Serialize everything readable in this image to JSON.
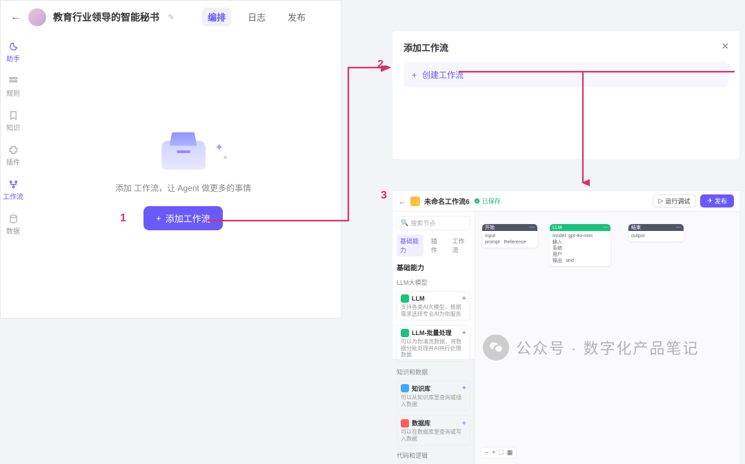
{
  "header": {
    "title": "教育行业领导的智能秘书",
    "tabs": {
      "edit": "编排",
      "log": "日志",
      "publish": "发布"
    }
  },
  "sidebar": {
    "items": [
      {
        "label": "助手"
      },
      {
        "label": "规则"
      },
      {
        "label": "知识"
      },
      {
        "label": "插件"
      },
      {
        "label": "工作流"
      },
      {
        "label": "数据"
      }
    ]
  },
  "empty": {
    "text": "添加 工作流，让 Agent 做更多的事情",
    "button": "添加工作流"
  },
  "dialog": {
    "title": "添加工作流",
    "create": "创建工作流"
  },
  "editor": {
    "name": "未命名工作流6",
    "saved": "已保存",
    "debug": "运行调试",
    "publish": "发布",
    "search_placeholder": "搜索节点",
    "cat_tabs": {
      "basic": "基础能力",
      "plugin": "插件",
      "workflow": "工作流"
    },
    "section_basic": "基础能力",
    "group_llm": "LLM大模型",
    "nodes": {
      "llm": {
        "name": "LLM",
        "desc": "支持各类AI大模型，根据需求选择专业AI为你服务"
      },
      "llm_batch": {
        "name": "LLM-批量处理",
        "desc": "可以为你清洗数据，将数据分批处理并AI并行处理数据"
      }
    },
    "group_knowledge": "知识和数据",
    "nodes2": {
      "kb": {
        "name": "知识库",
        "desc": "可以从知识库里查询或插入数据"
      },
      "db": {
        "name": "数据库",
        "desc": "可以在数据库里查询或写入数据"
      }
    },
    "group_code": "代码和逻辑",
    "canvas_nodes": {
      "start": "开始",
      "llm": "LLM",
      "end": "结束"
    }
  },
  "steps": {
    "s1": "1",
    "s2": "2",
    "s3": "3"
  },
  "watermark": {
    "text": "公众号 · 数字化产品笔记"
  }
}
